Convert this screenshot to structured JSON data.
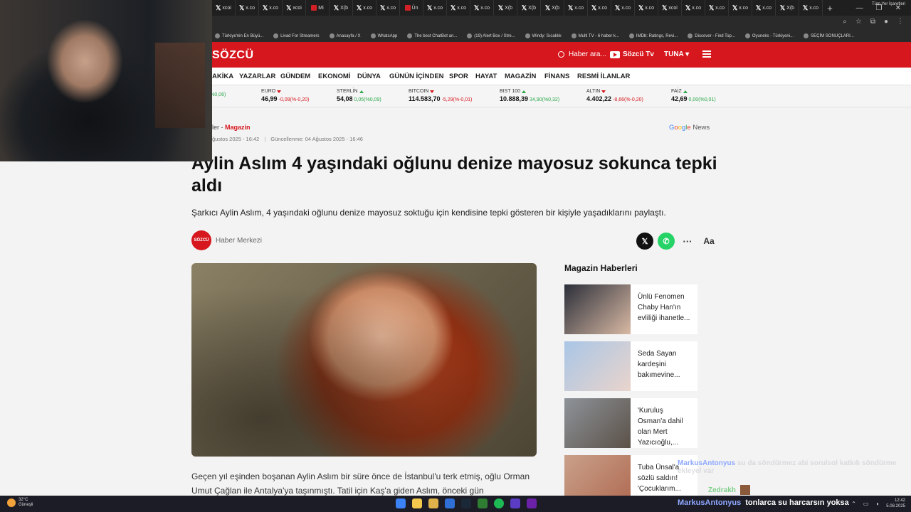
{
  "browser": {
    "tabs": [
      {
        "icon": "x-icon",
        "label": "xcoi"
      },
      {
        "icon": "x-icon",
        "label": "x.co"
      },
      {
        "icon": "x-icon",
        "label": "x.co"
      },
      {
        "icon": "x-icon",
        "label": "xcoi"
      },
      {
        "icon": "red-icon",
        "label": "Mi"
      },
      {
        "icon": "x-icon",
        "label": "X(b"
      },
      {
        "icon": "x-icon",
        "label": "x.co"
      },
      {
        "icon": "x-icon",
        "label": "x.co"
      },
      {
        "icon": "red-icon",
        "label": "Ün"
      },
      {
        "icon": "x-icon",
        "label": "x.co"
      },
      {
        "icon": "x-icon",
        "label": "x.co"
      },
      {
        "icon": "x-icon",
        "label": "x.co"
      },
      {
        "icon": "x-icon",
        "label": "X(b"
      },
      {
        "icon": "x-icon",
        "label": "X(b"
      },
      {
        "icon": "x-icon",
        "label": "X(b"
      },
      {
        "icon": "x-icon",
        "label": "x.co"
      },
      {
        "icon": "x-icon",
        "label": "x.co"
      },
      {
        "icon": "x-icon",
        "label": "x.co"
      },
      {
        "icon": "x-icon",
        "label": "x.co"
      },
      {
        "icon": "x-icon",
        "label": "xcoi"
      },
      {
        "icon": "x-icon",
        "label": "x.co"
      },
      {
        "icon": "x-icon",
        "label": "x.co"
      },
      {
        "icon": "x-icon",
        "label": "x.co"
      },
      {
        "icon": "x-icon",
        "label": "x.co"
      },
      {
        "icon": "x-icon",
        "label": "X(b"
      },
      {
        "icon": "x-icon",
        "label": "x.co"
      }
    ],
    "new_tab": "+",
    "bookmarks": [
      "Türkiye'nin En Büyü...",
      "Livad For Streamers",
      "Anasayfa / X",
      "WhatsApp",
      "The best ChatBot an...",
      "(19) Alert Box / Stre...",
      "Windy: Sıcaklık",
      "Multi TV - 6 haber k...",
      "IMDb: Ratings, Revi...",
      "Discover - Find Top...",
      "Oyuneks - Türkiyeni...",
      "SEÇİM SONUÇLARI..."
    ],
    "bookmarks_right": "Tüm Yer İşaretleri"
  },
  "site": {
    "logo": "SÖZCÜ",
    "search_label": "Haber ara...",
    "tv_label": "Sözcü Tv",
    "user_label": "TUNA ▾",
    "nav": [
      "AKİKA",
      "YAZARLAR",
      "GÜNDEM",
      "EKONOMİ",
      "DÜNYA",
      "GÜNÜN İÇİNDEN",
      "SPOR",
      "HAYAT",
      "MAGAZİN",
      "FİNANS",
      "RESMİ İLANLAR"
    ]
  },
  "markets": [
    {
      "name": "",
      "value": "",
      "change": "02(%0,06)",
      "dir": "up"
    },
    {
      "name": "EURO",
      "value": "46,99",
      "change": "-0,09(%-0,20)",
      "dir": "down"
    },
    {
      "name": "STERLİN",
      "value": "54,08",
      "change": "0,05(%0,09)",
      "dir": "up"
    },
    {
      "name": "BITCOIN",
      "value": "114.583,70",
      "change": "-5,29(%-0,01)",
      "dir": "down"
    },
    {
      "name": "BIST 100",
      "value": "10.888,39",
      "change": "34,90(%0,32)",
      "dir": "up"
    },
    {
      "name": "ALTIN",
      "value": "4.402,22",
      "change": "-8,66(%-0,20)",
      "dir": "down"
    },
    {
      "name": "FAİZ",
      "value": "42,69",
      "change": "0,00(%0,01)",
      "dir": "up"
    }
  ],
  "article": {
    "crumb_prefix": "ler - ",
    "crumb_section": "Magazin",
    "published": "ğustos 2025 - 16:42",
    "updated_label": "Güncellenme:",
    "updated": "04 Ağustos 2025 - 16:46",
    "google_news_g": "Google",
    "google_news_n": "News",
    "title": "Aylin Aslım 4 yaşındaki oğlunu denize mayosuz sokunca tepki aldı",
    "subtitle": "Şarkıcı Aylin Aslım, 4 yaşındaki oğlunu denize mayosuz soktuğu için kendisine tepki gösteren bir kişiyle yaşadıklarını paylaştı.",
    "author_logo": "SÖZCÜ",
    "author": "Haber Merkezi",
    "share": {
      "x": "𝕏",
      "whatsapp": "✆",
      "more": "···",
      "font": "Aa"
    },
    "body": "Geçen yıl eşinden boşanan Aylin Aslım bir süre önce de İstanbul'u terk etmiş, oğlu Orman Umut Çağlan  ile Antalya'ya taşınmıştı. Tatil için Kaş'a giden Aslım, önceki gün"
  },
  "sidebar": {
    "title": "Magazin Haberleri",
    "items": [
      {
        "text": "Ünlü Fenomen Chaby Han'ın evliliği ihanetle...",
        "thumb": [
          "#2b2f3a",
          "#d9b9a4"
        ]
      },
      {
        "text": "Seda Sayan kardeşini bakımevine...",
        "thumb": [
          "#a9c6e6",
          "#e9d4cc"
        ]
      },
      {
        "text": "'Kuruluş Osman'a dahil olan Mert Yazıcıoğlu,...",
        "thumb": [
          "#8e9399",
          "#5b5148"
        ]
      },
      {
        "text": "Tuba Ünsal'a sözlü saldırı! 'Çocuklarım...",
        "thumb": [
          "#c9a18a",
          "#b06a52"
        ]
      }
    ]
  },
  "chat": {
    "user1": "MarkusAntonyus",
    "msg1": "su da söndürmez abi sorulsol katkılı söndürme ekleyel var",
    "user2": "Zedrakh"
  },
  "taskbar": {
    "temp": "32°C",
    "weather": "Güneşli",
    "tray_user": "MarkusAntonyus",
    "tray_msg": "tonlarca su harcarsın yoksa",
    "time": "12:42",
    "date": "5.08.2025"
  }
}
